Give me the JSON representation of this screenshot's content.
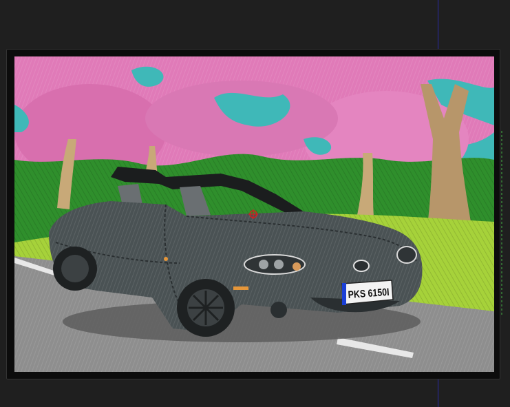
{
  "colors": {
    "background": "#1f1f1f",
    "hoop_frame": "#0c0c0c",
    "guide_line": "#2a2aa8",
    "sky": "#3fb8b8",
    "blossom": "#e07ab8",
    "grass": "#3a9a32",
    "lawn": "#a6d23a",
    "road": "#8e8e8e",
    "car_body": "#4a5254",
    "cursor": "#d11f1f"
  },
  "car": {
    "plate_text": "PKS 6150I"
  },
  "icons": {
    "cursor": "crosshair-target-icon"
  }
}
